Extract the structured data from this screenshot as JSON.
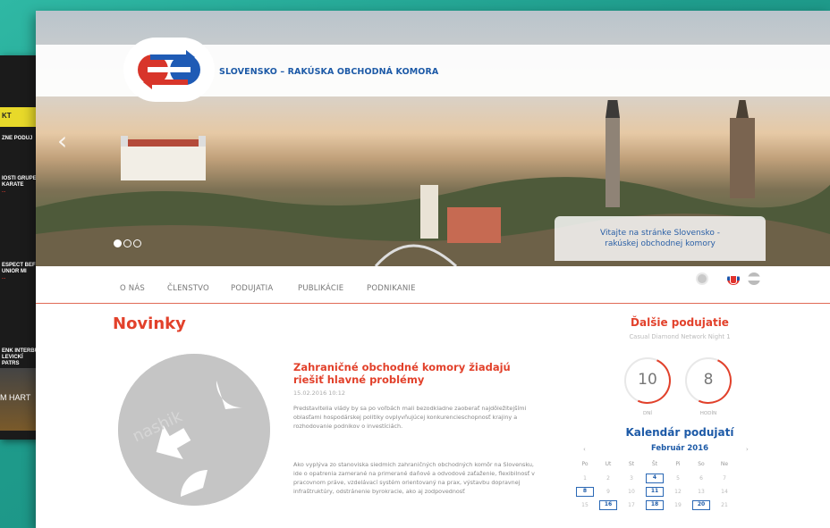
{
  "bg_window": {
    "items": [
      {
        "title": "KT",
        "sub": ""
      },
      {
        "title": "ZNE PODUJ",
        "sub": ""
      },
      {
        "title": "IOSTI GRUPE KARATE",
        "sub": "..."
      },
      {
        "title": "ESPECT BEF UNIOR MI",
        "sub": "..."
      },
      {
        "title": "ENK INTERBU LEVICKÍ PATRS",
        "sub": "..."
      }
    ],
    "thumb": "M HART"
  },
  "site": {
    "name": "SLOVENSKO – RAKÚSKA OBCHODNÁ KOMORA",
    "welcome_line1": "Vitajte na stránke Slovensko -",
    "welcome_line2": "rakúskej obchodnej komory"
  },
  "nav": {
    "items": [
      "O NÁS",
      "ČLENSTVO",
      "PODUJATIA",
      "PUBLIKÁCIE",
      "PODNIKANIE"
    ]
  },
  "news": {
    "heading": "Novinky",
    "article": {
      "title": "Zahraničné obchodné komory žiadajú riešiť hlavné problémy",
      "date": "15.02.2016 10:12",
      "para1": "Predstavitelia vlády by sa po voľbách mali bezodkladne zaoberať najdôležitejšími oblasťami hospodárskej politiky ovplyvňujúcej konkurencieschopnosť krajiny a rozhodovanie podnikov o investíciách.",
      "para2": "Ako vyplýva zo stanoviska siedmich zahraničných obchodných komôr na Slovensku, ide o opatrenia zamerané na primerané daňové a odvodové zaťaženie, flexibilnosť v pracovnom práve, vzdelávací systém orientovaný na prax, výstavbu dopravnej infraštruktúry, odstránenie byrokracie, ako aj zodpovednosť"
    }
  },
  "sidebar": {
    "next_event_title": "Ďalšie podujatie",
    "next_event_name": "Casual Diamond Network Night 1",
    "days_value": "10",
    "days_label": "DNÍ",
    "hours_value": "8",
    "hours_label": "HODÍN",
    "calendar_title": "Kalendár podujatí",
    "calendar_month": "Február 2016",
    "prev": "‹",
    "next": "›",
    "weekdays": [
      "Po",
      "Ut",
      "St",
      "Št",
      "Pi",
      "So",
      "Ne"
    ],
    "rows": [
      [
        "1",
        "2",
        "3",
        "4",
        "5",
        "6",
        "7"
      ],
      [
        "8",
        "9",
        "10",
        "11",
        "12",
        "13",
        "14"
      ],
      [
        "15",
        "16",
        "17",
        "18",
        "19",
        "20",
        "21"
      ]
    ],
    "event_days": [
      "4",
      "8",
      "11",
      "16",
      "18",
      "20"
    ]
  },
  "colors": {
    "accent_red": "#e2412b",
    "brand_blue": "#1d5aa7"
  }
}
